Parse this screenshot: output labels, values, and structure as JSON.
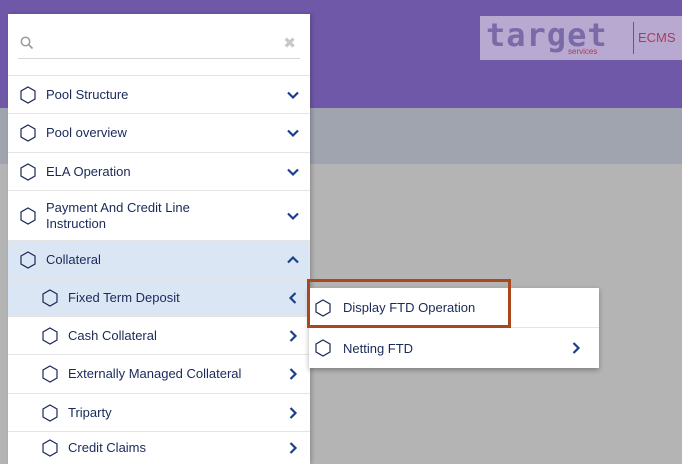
{
  "app": {
    "logo_word": "target",
    "logo_sub": "services",
    "logo_product": "ECMS"
  },
  "search": {
    "placeholder": "",
    "value": "",
    "search_icon": "magnifier-icon",
    "clear_icon": "close-icon"
  },
  "menu": {
    "items": [
      {
        "label": "Pool Structure",
        "chevron": "down"
      },
      {
        "label": "Pool overview",
        "chevron": "down"
      },
      {
        "label": "ELA Operation",
        "chevron": "down"
      },
      {
        "label": "Payment And Credit Line Instruction",
        "chevron": "down"
      },
      {
        "label": "Collateral",
        "chevron": "up"
      },
      {
        "label": "Fixed Term Deposit",
        "chevron": "left"
      },
      {
        "label": "Cash Collateral",
        "chevron": "right"
      },
      {
        "label": "Externally Managed Collateral",
        "chevron": "right"
      },
      {
        "label": "Triparty",
        "chevron": "right"
      },
      {
        "label": "Credit Claims",
        "chevron": "right"
      }
    ]
  },
  "submenu": {
    "items": [
      {
        "label": "Display FTD Operation"
      },
      {
        "label": "Netting FTD",
        "chevron": "right"
      }
    ]
  },
  "colors": {
    "header": "#6f58a8",
    "band": "#9fa4ae",
    "background": "#b4b4b4",
    "menu_text": "#1a2a58",
    "chevron": "#1b3f8f",
    "active_row": "#dbe6f5",
    "highlight_border": "#a8481c"
  }
}
